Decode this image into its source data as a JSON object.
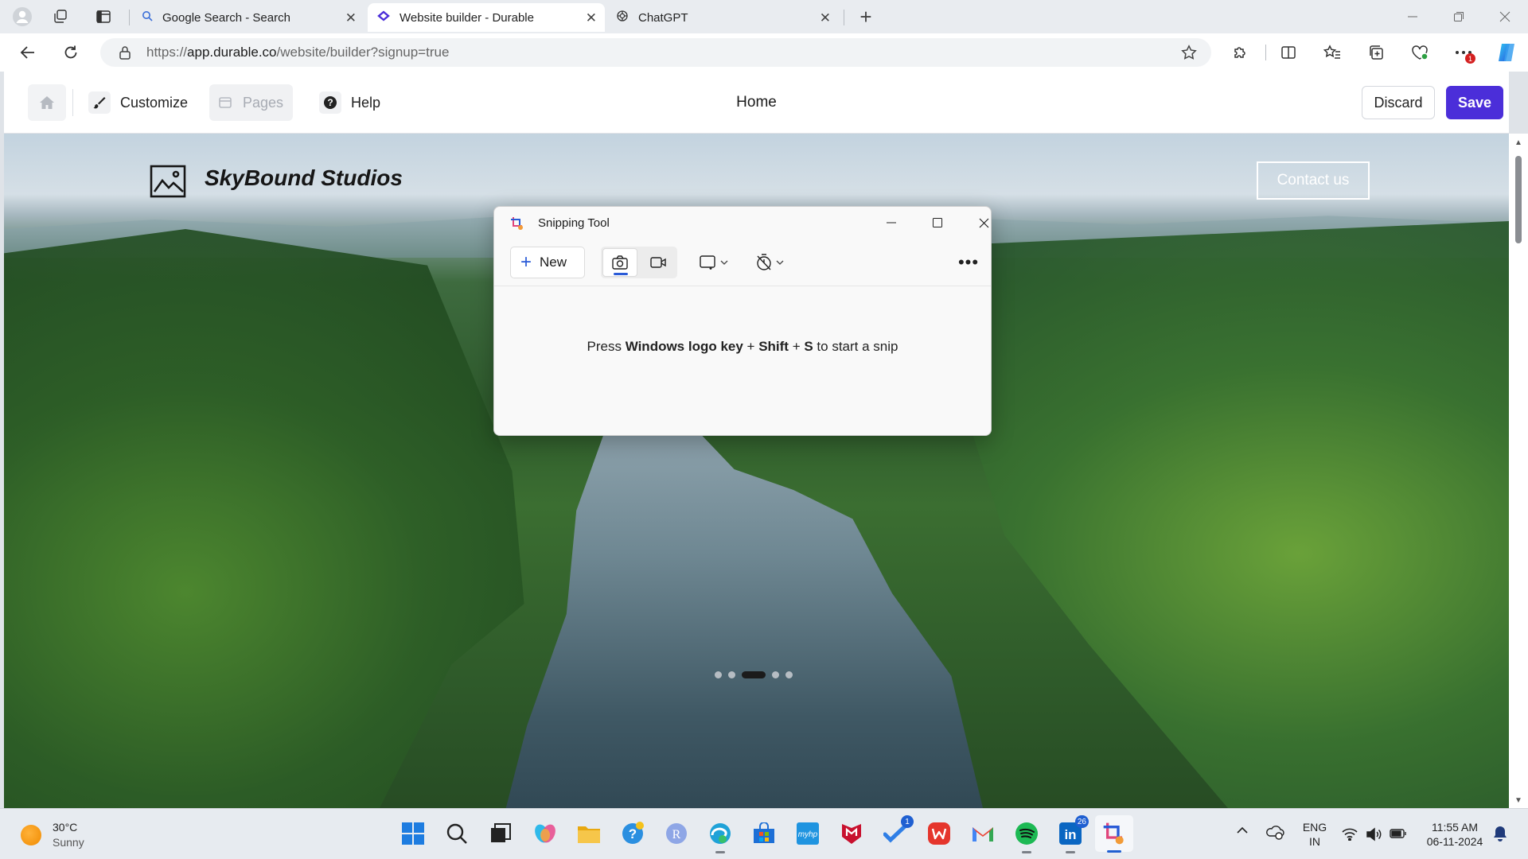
{
  "browser": {
    "tabs": [
      {
        "title": "Google Search - Search",
        "icon": "search-icon",
        "active": false
      },
      {
        "title": "Website builder - Durable",
        "icon": "durable-icon",
        "active": true
      },
      {
        "title": "ChatGPT",
        "icon": "chatgpt-icon",
        "active": false
      }
    ],
    "url_prefix": "https://",
    "url_host": "app.durable.co",
    "url_path": "/website/builder?signup=true",
    "close_glyph": "✕",
    "new_tab_glyph": "+",
    "notification_badge": "1"
  },
  "builder": {
    "customize_label": "Customize",
    "pages_label": "Pages",
    "help_label": "Help",
    "page_name": "Home",
    "discard_label": "Discard",
    "save_label": "Save",
    "accent_color": "#4b2ed9"
  },
  "site": {
    "name": "SkyBound Studios",
    "contact_label": "Contact us",
    "slider_dots": 5,
    "active_slide": 3
  },
  "snipping_tool": {
    "title": "Snipping Tool",
    "new_label": "New",
    "more_glyph": "•••",
    "message_parts": [
      "Press ",
      "Windows logo key",
      " + ",
      "Shift",
      " + ",
      "S",
      " to start a snip"
    ]
  },
  "taskbar": {
    "temperature": "30°C",
    "condition": "Sunny",
    "language": "ENG",
    "region": "IN",
    "time": "11:55 AM",
    "date": "06-11-2024",
    "todo_badge": "1",
    "linkedin_badge": "26"
  }
}
